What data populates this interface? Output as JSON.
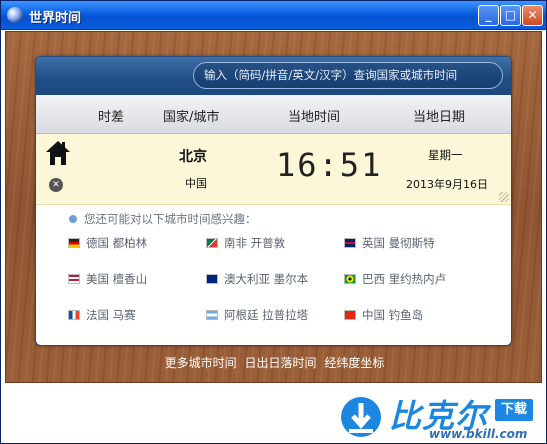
{
  "window": {
    "title": "世界时间",
    "min": "_",
    "max": "□",
    "close": "✕"
  },
  "search": {
    "placeholder": "输入（简码/拼音/英文/汉字）查询国家或城市时间"
  },
  "columns": {
    "offset": "时差",
    "country_city": "国家/城市",
    "local_time": "当地时间",
    "local_date": "当地日期"
  },
  "current": {
    "city": "北京",
    "country": "中国",
    "time": "16:51",
    "weekday": "星期一",
    "date": "2013年9月16日"
  },
  "suggestions": {
    "title": "您还可能对以下城市时间感兴趣：",
    "items": [
      {
        "label": "德国 都柏林",
        "flag": "germany-flag"
      },
      {
        "label": "南非 开普敦",
        "flag": "south-africa-flag"
      },
      {
        "label": "英国 曼彻斯特",
        "flag": "uk-flag"
      },
      {
        "label": "美国 檀香山",
        "flag": "usa-flag"
      },
      {
        "label": "澳大利亚 墨尔本",
        "flag": "australia-flag"
      },
      {
        "label": "巴西 里约热内卢",
        "flag": "brazil-flag"
      },
      {
        "label": "法国 马赛",
        "flag": "france-flag"
      },
      {
        "label": "阿根廷 拉普拉塔",
        "flag": "argentina-flag"
      },
      {
        "label": "中国 钓鱼岛",
        "flag": "china-flag"
      }
    ]
  },
  "links": {
    "more_cities": "更多城市时间",
    "sunrise_sunset": "日出日落时间",
    "coordinates": "经纬度坐标"
  },
  "watermark": {
    "brand": "比克尔",
    "download": "下载",
    "url": "www.bkill.com"
  },
  "colors": {
    "titlebar": "#0a5fe0",
    "panel_header": "#1f4d86",
    "current_row": "#fcf7d8",
    "wood": "#9b5f38",
    "brand": "#1d87e0"
  }
}
